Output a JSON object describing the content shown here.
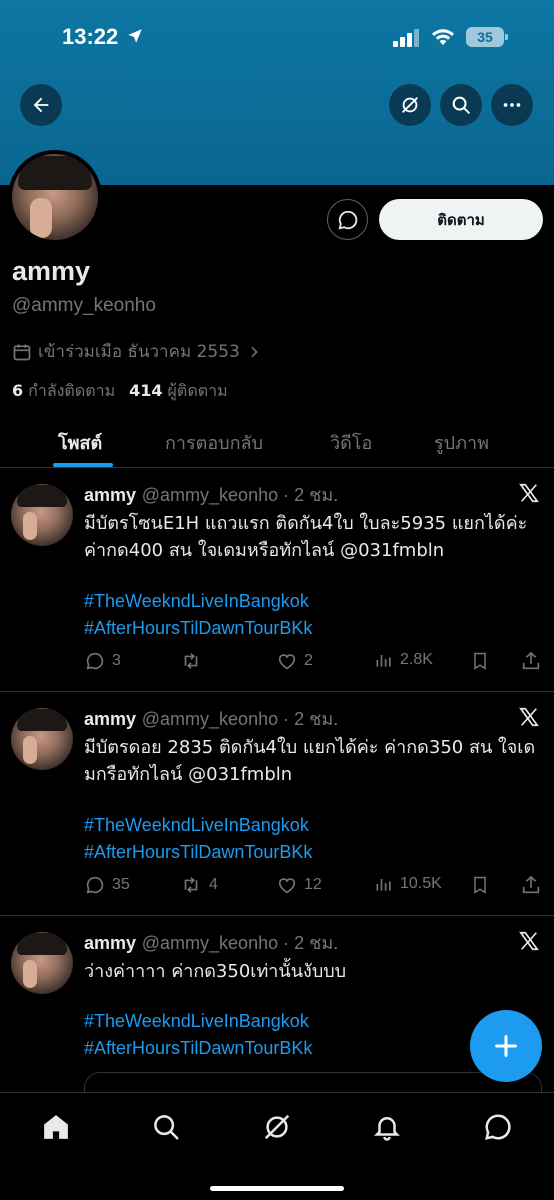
{
  "status_bar": {
    "time": "13:22",
    "battery": "35"
  },
  "profile": {
    "follow_label": "ติดตาม",
    "display_name": "ammy",
    "handle": "@ammy_keonho",
    "joined": "เข้าร่วมเมือ ธันวาคม 2553",
    "following_count": "6",
    "following_label": "กำลังติดตาม",
    "followers_count": "414",
    "followers_label": "ผู้ติดตาม"
  },
  "tabs": [
    {
      "label": "โพสต์",
      "active": true
    },
    {
      "label": "การตอบกลับ",
      "active": false
    },
    {
      "label": "วิดีโอ",
      "active": false
    },
    {
      "label": "รูปภาพ",
      "active": false
    }
  ],
  "tweets": [
    {
      "name": "ammy",
      "meta": "@ammy_keonho · 2 ชม.",
      "text": "มีบัตรโซนE1H แถวแรก ติดกัน4ใบ  ใบละ5935 แยกได้ค่ะ ค่ากด400 สน ใจเดมหรือทักไลน์ @031fmbln",
      "tag1": "#TheWeekndLiveInBangkok",
      "tag2": "#AfterHoursTilDawnTourBKk",
      "replies": "3",
      "reposts": "",
      "likes": "2",
      "views": "2.8K"
    },
    {
      "name": "ammy",
      "meta": "@ammy_keonho · 2 ชม.",
      "text": "มีบัตรดอย 2835 ติดกัน4ใบ แยกได้ค่ะ ค่ากด350 สน ใจเดมกรือทักไลน์ @031fmbln",
      "tag1": "#TheWeekndLiveInBangkok",
      "tag2": "#AfterHoursTilDawnTourBKk",
      "replies": "35",
      "reposts": "4",
      "likes": "12",
      "views": "10.5K"
    },
    {
      "name": "ammy",
      "meta": "@ammy_keonho · 2 ชม.",
      "text": "ว่างค่าาาา ค่ากด350เท่านั้นงับบบ",
      "tag1": "#TheWeekndLiveInBangkok",
      "tag2": "#AfterHoursTilDawnTourBKk"
    }
  ],
  "colors": {
    "accent": "#1d9bf0",
    "banner": "#0b6d98",
    "background": "#000000"
  }
}
